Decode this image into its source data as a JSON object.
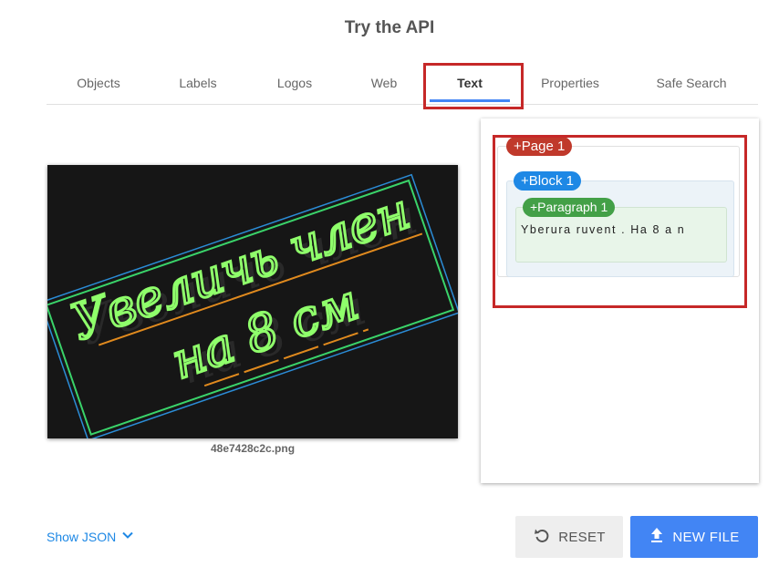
{
  "header": {
    "title": "Try the API"
  },
  "tabs": [
    {
      "label": "Objects",
      "active": false
    },
    {
      "label": "Labels",
      "active": false
    },
    {
      "label": "Logos",
      "active": false
    },
    {
      "label": "Web",
      "active": false
    },
    {
      "label": "Text",
      "active": true
    },
    {
      "label": "Properties",
      "active": false
    },
    {
      "label": "Safe Search",
      "active": false
    }
  ],
  "image": {
    "filename": "48e7428c2c.png",
    "neon_text_line1": "Увеличь член",
    "neon_text_line2": "на 8 см"
  },
  "result": {
    "page_label": "+Page 1",
    "block_label": "+Block 1",
    "paragraph_label": "+Paragraph 1",
    "paragraph_text": "Yberura ruvent . Ha 8 a n"
  },
  "footer": {
    "show_json_label": "Show JSON",
    "reset_label": "RESET",
    "new_file_label": "NEW FILE"
  },
  "colors": {
    "accent": "#4285f4",
    "highlight": "#c62828",
    "page_tag": "#c0392b",
    "block_tag": "#1e88e5",
    "paragraph_tag": "#43a047"
  },
  "icons": {
    "show_json": "chevron-down-icon",
    "reset": "reset-icon",
    "new_file": "upload-icon"
  }
}
